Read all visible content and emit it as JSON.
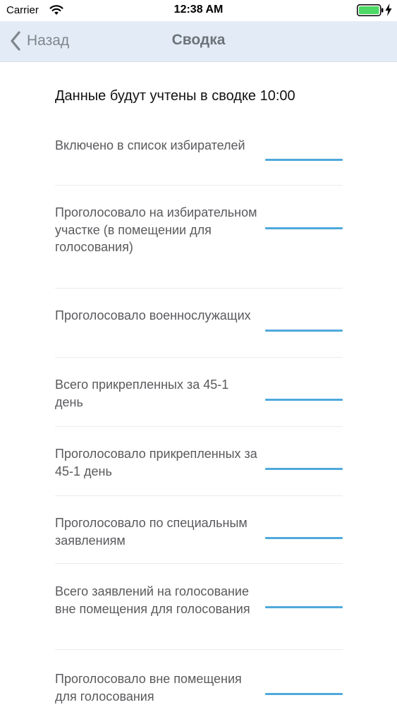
{
  "status_bar": {
    "carrier": "Carrier",
    "time": "12:38 AM",
    "wifi_icon": "wifi-icon",
    "battery_icon": "battery-icon",
    "battery_color": "#4cd964"
  },
  "nav": {
    "back_label": "Назад",
    "title": "Сводка",
    "background": "#e3ecf6"
  },
  "notice": "Данные будут учтены в сводке 10:00",
  "accent_color": "#4fa9db",
  "rows": [
    {
      "label": "Включено в список избирателей",
      "value": ""
    },
    {
      "label": "Проголосовало на избирательном участке (в помещении для голосования)",
      "value": ""
    },
    {
      "label": "Проголосовало военнослужащих",
      "value": ""
    },
    {
      "label": "Всего прикрепленных за 45-1 день",
      "value": ""
    },
    {
      "label": "Проголосовало прикрепленных за 45-1 день",
      "value": ""
    },
    {
      "label": "Проголосовало по специальным заявлениям",
      "value": ""
    },
    {
      "label": "Всего заявлений на голосование вне помещения для голосования",
      "value": ""
    },
    {
      "label": "Проголосовало вне помещения для голосования",
      "value": ""
    }
  ]
}
